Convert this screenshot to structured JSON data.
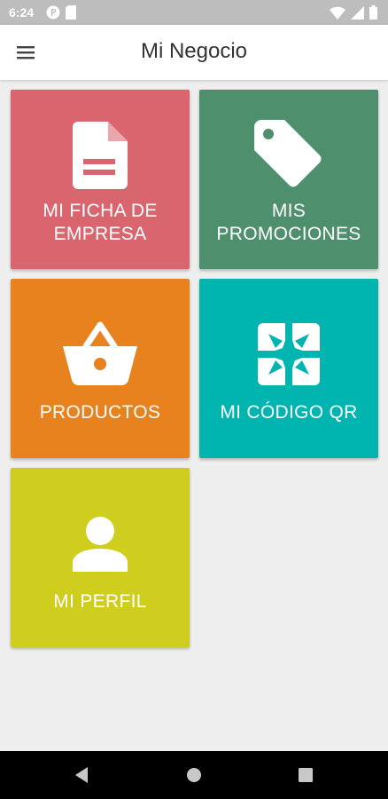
{
  "status_bar": {
    "time": "6:24",
    "left_icons": [
      "notification-p-icon",
      "sd-card-icon"
    ],
    "right_icons": [
      "wifi-icon",
      "signal-icon",
      "battery-icon"
    ]
  },
  "app_bar": {
    "title": "Mi Negocio",
    "menu_icon": "hamburger-menu-icon"
  },
  "tiles": [
    {
      "label": "MI FICHA DE EMPRESA",
      "icon": "document-icon",
      "color": "#d9666f"
    },
    {
      "label": "MIS PROMOCIONES",
      "icon": "price-tag-icon",
      "color": "#4e8f6e"
    },
    {
      "label": "PRODUCTOS",
      "icon": "basket-icon",
      "color": "#e8821f"
    },
    {
      "label": "MI CÓDIGO QR",
      "icon": "qr-code-icon",
      "color": "#00b5b0"
    },
    {
      "label": "MI PERFIL",
      "icon": "person-icon",
      "color": "#cfcd1d"
    }
  ],
  "nav_bar": {
    "buttons": [
      "back-icon",
      "home-icon",
      "recents-icon"
    ]
  }
}
